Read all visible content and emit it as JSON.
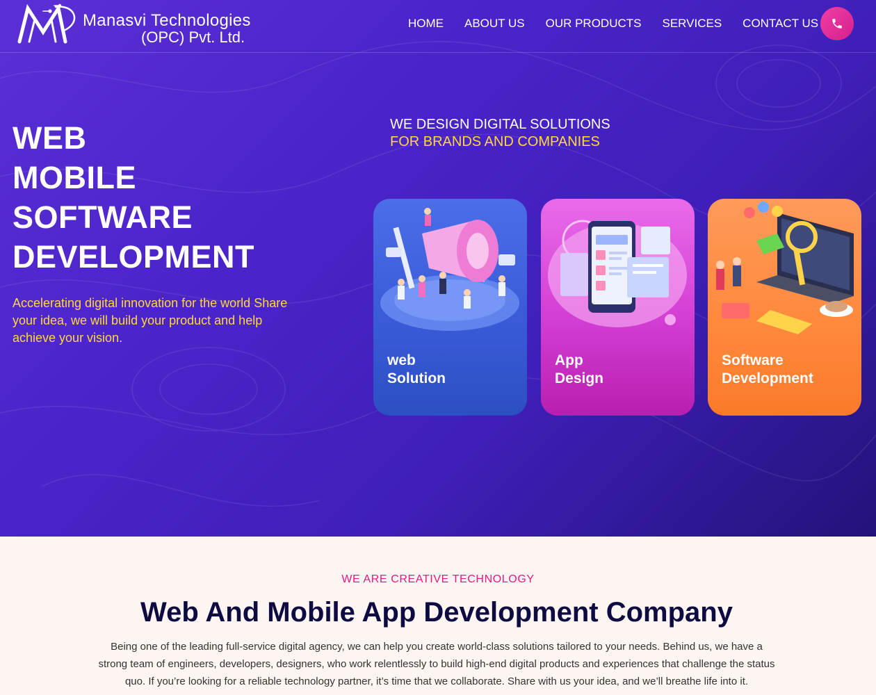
{
  "brand": {
    "name_line1": "Manasvi Technologies",
    "name_line2": "(OPC) Pvt. Ltd."
  },
  "nav": {
    "items": [
      {
        "label": "HOME"
      },
      {
        "label": "ABOUT US"
      },
      {
        "label": "OUR PRODUCTS"
      },
      {
        "label": "SERVICES"
      },
      {
        "label": "CONTACT US"
      }
    ],
    "call_icon": "phone-icon"
  },
  "hero": {
    "headline": [
      "WEB",
      "MOBILE",
      "SOFTWARE",
      "DEVELOPMENT"
    ],
    "tagline": "Accelerating digital innovation for the world Share your idea, we will build your product and help achieve your vision.",
    "subheading_line1": "WE DESIGN DIGITAL SOLUTIONS",
    "subheading_line2": "FOR BRANDS AND COMPANIES"
  },
  "cards": [
    {
      "line1": "web",
      "line2": "Solution",
      "icon": "megaphone-illustration"
    },
    {
      "line1": "App",
      "line2": "Design",
      "icon": "mobile-app-illustration"
    },
    {
      "line1": "Software",
      "line2": "Development",
      "icon": "laptop-illustration"
    }
  ],
  "intro": {
    "eyebrow": "WE ARE CREATIVE TECHNOLOGY",
    "title": "Web And Mobile App Development Company",
    "body": "Being one of the leading full-service digital agency, we can help you create world-class solutions tailored to your needs. Behind us, we have a strong team of engineers, developers, designers, who work relentlessly to build high-end digital products and experiences that challenge the status quo. If you’re looking for a reliable technology partner, it’s time that we collaborate. Share with us your idea, and we’ll breathe life into it."
  },
  "colors": {
    "accent_yellow": "#ffd83a",
    "accent_pink": "#e2197f",
    "hero_purple": "#4a24c9",
    "title_navy": "#0e0a42"
  }
}
